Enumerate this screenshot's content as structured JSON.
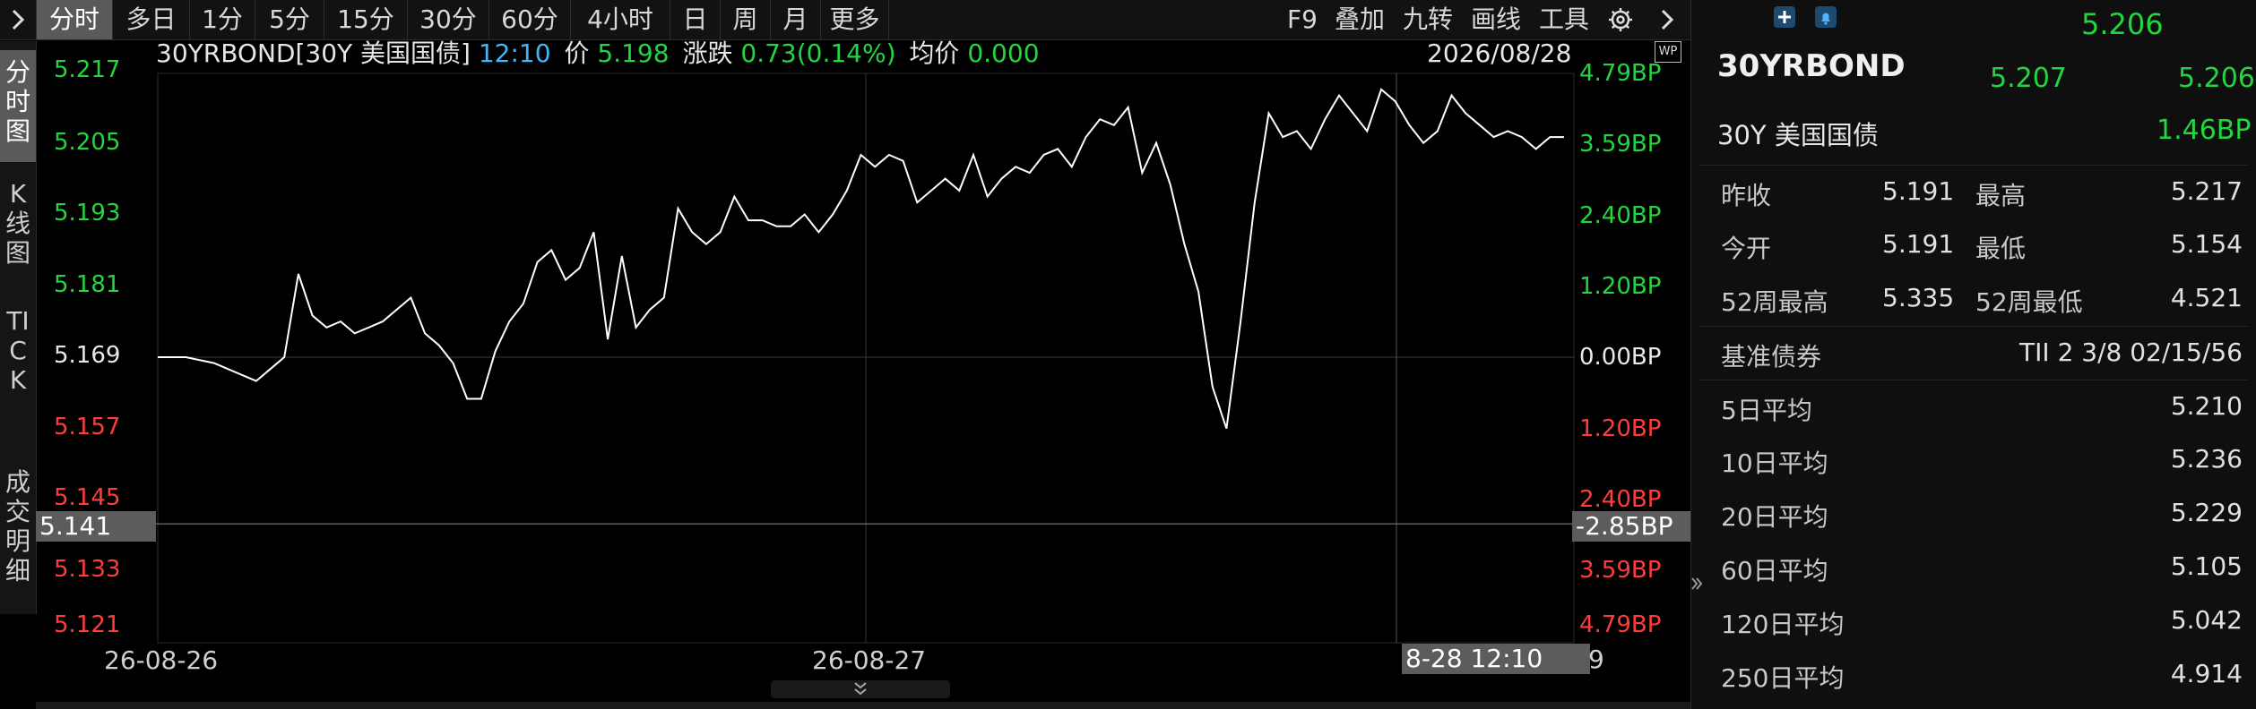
{
  "toolbar": {
    "collapse_icon": "chevron-right-icon",
    "periods": [
      "分时",
      "多日",
      "1分",
      "5分",
      "15分",
      "30分",
      "60分",
      "4小时",
      "日",
      "周",
      "月",
      "更多"
    ],
    "active_period": "分时",
    "right_tools": [
      "F9",
      "叠加",
      "九转",
      "画线",
      "工具"
    ],
    "settings_icon": "gear-icon",
    "expand_icon": "chevron-right-icon"
  },
  "side_tabs": [
    {
      "label": "分时图",
      "active": true
    },
    {
      "label": "K线图",
      "active": false
    },
    {
      "label": "TICK",
      "active": false
    },
    {
      "label": "成交明细",
      "active": false
    }
  ],
  "info": {
    "name": "30YRBOND[30Y 美国国债]",
    "time": "12:10",
    "price_label": "价",
    "price": "5.198",
    "change_label": "涨跌",
    "change": "0.73(0.14%)",
    "avg_label": "均价",
    "avg": "0.000",
    "date": "2026/08/28",
    "wp_badge": "WP"
  },
  "y_axis_left": [
    "5.217",
    "5.205",
    "5.193",
    "5.181",
    "5.169",
    "5.157",
    "5.145",
    "5.133",
    "5.121"
  ],
  "y_axis_right": [
    "4.79BP",
    "3.59BP",
    "2.40BP",
    "1.20BP",
    "0.00BP",
    "1.20BP",
    "2.40BP",
    "3.59BP",
    "4.79BP"
  ],
  "x_axis": [
    "26-08-26",
    "26-08-27"
  ],
  "crosshair": {
    "y_value": "5.141",
    "bp_value": "-2.85BP",
    "time_value": "8-28 12:10",
    "trailing": "9"
  },
  "chart_data": {
    "type": "line",
    "title": "",
    "xlabel": "",
    "ylabel": "",
    "ylim": [
      5.121,
      5.217
    ],
    "grid": true,
    "x": [
      0,
      2,
      4,
      6,
      7,
      8,
      9,
      10,
      11,
      12,
      13,
      14,
      15,
      16,
      17,
      18,
      19,
      20,
      21,
      22,
      23,
      24,
      25,
      26,
      27,
      28,
      29,
      30,
      31,
      32,
      33,
      34,
      35,
      36,
      37,
      38,
      39,
      40,
      41,
      42,
      43,
      44,
      45,
      46,
      47,
      48,
      49,
      50,
      51,
      52,
      53,
      54,
      55,
      56,
      57,
      58,
      59,
      60,
      61,
      62,
      63,
      64,
      65,
      66,
      67,
      68,
      69,
      70,
      71,
      72,
      73,
      74,
      75,
      76,
      77,
      78,
      79,
      80,
      81,
      82,
      83,
      84,
      85,
      86,
      87,
      88,
      89,
      90,
      91,
      92,
      93,
      94,
      95,
      96,
      97,
      98,
      99,
      100
    ],
    "series": [
      {
        "values": [
          5.169,
          5.169,
          5.168,
          5.166,
          5.165,
          5.167,
          5.169,
          5.183,
          5.176,
          5.174,
          5.175,
          5.173,
          5.174,
          5.175,
          5.177,
          5.179,
          5.173,
          5.171,
          5.168,
          5.162,
          5.162,
          5.17,
          5.175,
          5.178,
          5.185,
          5.187,
          5.182,
          5.184,
          5.19,
          5.172,
          5.186,
          5.174,
          5.177,
          5.179,
          5.194,
          5.19,
          5.188,
          5.19,
          5.196,
          5.192,
          5.192,
          5.191,
          5.191,
          5.193,
          5.19,
          5.193,
          5.197,
          5.203,
          5.201,
          5.203,
          5.202,
          5.195,
          5.197,
          5.199,
          5.197,
          5.203,
          5.196,
          5.199,
          5.201,
          5.2,
          5.203,
          5.204,
          5.201,
          5.206,
          5.209,
          5.208,
          5.211,
          5.2,
          5.205,
          5.198,
          5.188,
          5.18,
          5.164,
          5.157,
          5.175,
          5.195,
          5.21,
          5.206,
          5.207,
          5.204,
          5.209,
          5.213,
          5.21,
          5.207,
          5.214,
          5.212,
          5.208,
          5.205,
          5.207,
          5.213,
          5.21,
          5.208,
          5.206,
          5.207,
          5.206,
          5.204,
          5.206,
          5.206
        ]
      }
    ]
  },
  "panel": {
    "add_icon": "plus-icon",
    "alert_icon": "bell-icon",
    "last": "5.206",
    "symbol": "30YRBOND",
    "bid": "5.207",
    "ask": "5.206",
    "subtitle": "30Y 美国国债",
    "bp_change": "1.46BP",
    "stats": [
      {
        "l1": "昨收",
        "v1": "5.191",
        "l2": "最高",
        "v2": "5.217",
        "c2": "green"
      },
      {
        "l1": "今开",
        "v1": "5.191",
        "l2": "最低",
        "v2": "5.154",
        "c2": "red"
      },
      {
        "l1": "52周最高",
        "v1": "5.335",
        "l2": "52周最低",
        "v2": "4.521",
        "c2": "white"
      }
    ],
    "benchmark_label": "基准债券",
    "benchmark_value": "TII 2 3/8 02/15/56",
    "averages": [
      {
        "label": "5日平均",
        "value": "5.210"
      },
      {
        "label": "10日平均",
        "value": "5.236"
      },
      {
        "label": "20日平均",
        "value": "5.229"
      },
      {
        "label": "60日平均",
        "value": "5.105"
      },
      {
        "label": "120日平均",
        "value": "5.042"
      },
      {
        "label": "250日平均",
        "value": "4.914"
      }
    ],
    "panel_toggle_icon": "double-chevron-right-icon"
  },
  "colors": {
    "up": "#22d63f",
    "down": "#ff3b3b",
    "time": "#3fb6ff",
    "line": "#ffffff"
  },
  "bottom_handle_icon": "double-chevron-down-icon"
}
